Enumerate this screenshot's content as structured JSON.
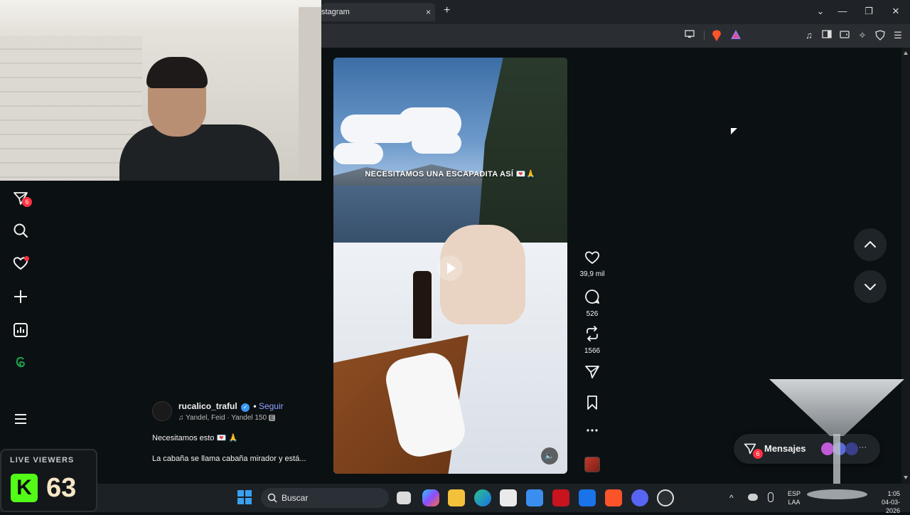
{
  "browser": {
    "tab_title": "stagram",
    "tab_close": "×",
    "new_tab": "+",
    "window_controls": {
      "dropdown": "⌄",
      "minimize": "—",
      "restore": "❐",
      "close": "✕"
    },
    "toolbar_icons": [
      "cast-icon",
      "brave-shield-icon",
      "brave-rewards-icon",
      "media-icon",
      "sidebar-icon",
      "wallet-icon",
      "leo-ai-icon",
      "vpn-icon",
      "menu-icon"
    ]
  },
  "sidebar": {
    "notifications_badge": "6",
    "items": [
      "home-icon",
      "search-icon",
      "heart-icon",
      "create-icon",
      "dashboard-icon",
      "threads-icon",
      "more-menu-icon"
    ]
  },
  "video": {
    "caption": "NECESITAMOS UNA ESCAPADITA ASÍ 💌🙏"
  },
  "actions": {
    "likes": "39,9 mil",
    "comments": "526",
    "reposts": "1566"
  },
  "post": {
    "username": "rucalico_traful",
    "verified_mark": "✓",
    "dot": "•",
    "follow": "Seguir",
    "music_note": "♫",
    "music": "Yandel, Feid · Yandel 150",
    "explicit": "E",
    "description_1": "Necesitamos esto 💌 🙏",
    "description_2": "La cabaña se llama cabaña mirador y está..."
  },
  "messages": {
    "label": "Mensajes",
    "badge": "6",
    "more": "···"
  },
  "live_viewers": {
    "label": "LIVE VIEWERS",
    "logo_letter": "K",
    "count": "63"
  },
  "taskbar": {
    "search_placeholder": "Buscar",
    "lang_1": "ESP",
    "lang_2": "LAA",
    "time": "1:05",
    "date": "04-03-2026",
    "apps": [
      "windows-start-icon",
      "search-icon",
      "task-view-icon",
      "copilot-icon",
      "file-explorer-icon",
      "edge-icon",
      "store-icon",
      "app-icon",
      "mcafee-icon",
      "outlook-icon",
      "brave-icon",
      "discord-icon",
      "chatgpt-icon"
    ]
  },
  "colors": {
    "accent_link": "#8fa4ff",
    "badge_red": "#ff3040",
    "kick_green": "#53fc18",
    "background": "#0b1012"
  }
}
